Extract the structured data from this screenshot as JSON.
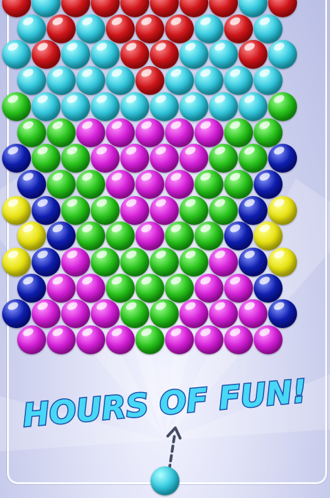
{
  "game": {
    "tagline": "HOURS OF FUN!",
    "shooter_color": "cyan"
  },
  "palette": {
    "red": "#d0161a",
    "cyan": "#36c9df",
    "green": "#29c41c",
    "magenta": "#d51fd8",
    "blue": "#0f1fb0",
    "yellow": "#e9e314",
    "tagline_fill": "#48d8f7",
    "tagline_outline": "#1b4fa8"
  },
  "board": {
    "rows": [
      [
        "red",
        "cyan",
        "red",
        "red",
        "red",
        "red",
        "red",
        "red",
        "cyan",
        "red"
      ],
      [
        "cyan",
        "red",
        "cyan",
        "red",
        "red",
        "red",
        "cyan",
        "red",
        "cyan"
      ],
      [
        "cyan",
        "red",
        "cyan",
        "cyan",
        "red",
        "red",
        "cyan",
        "cyan",
        "red",
        "cyan"
      ],
      [
        "cyan",
        "cyan",
        "cyan",
        "cyan",
        "red",
        "cyan",
        "cyan",
        "cyan",
        "cyan"
      ],
      [
        "green",
        "cyan",
        "cyan",
        "cyan",
        "cyan",
        "cyan",
        "cyan",
        "cyan",
        "cyan",
        "green"
      ],
      [
        "green",
        "green",
        "magenta",
        "magenta",
        "magenta",
        "magenta",
        "magenta",
        "green",
        "green"
      ],
      [
        "blue",
        "green",
        "green",
        "magenta",
        "magenta",
        "magenta",
        "magenta",
        "green",
        "green",
        "blue"
      ],
      [
        "blue",
        "green",
        "green",
        "magenta",
        "magenta",
        "magenta",
        "green",
        "green",
        "blue"
      ],
      [
        "yellow",
        "blue",
        "green",
        "green",
        "magenta",
        "magenta",
        "green",
        "green",
        "blue",
        "yellow"
      ],
      [
        "yellow",
        "blue",
        "green",
        "green",
        "magenta",
        "green",
        "green",
        "blue",
        "yellow"
      ],
      [
        "yellow",
        "blue",
        "magenta",
        "green",
        "green",
        "green",
        "green",
        "magenta",
        "blue",
        "yellow"
      ],
      [
        "blue",
        "magenta",
        "magenta",
        "green",
        "green",
        "green",
        "magenta",
        "magenta",
        "blue"
      ],
      [
        "blue",
        "magenta",
        "magenta",
        "magenta",
        "green",
        "green",
        "magenta",
        "magenta",
        "magenta",
        "blue"
      ],
      [
        "magenta",
        "magenta",
        "magenta",
        "magenta",
        "green",
        "magenta",
        "magenta",
        "magenta",
        "magenta"
      ]
    ]
  }
}
